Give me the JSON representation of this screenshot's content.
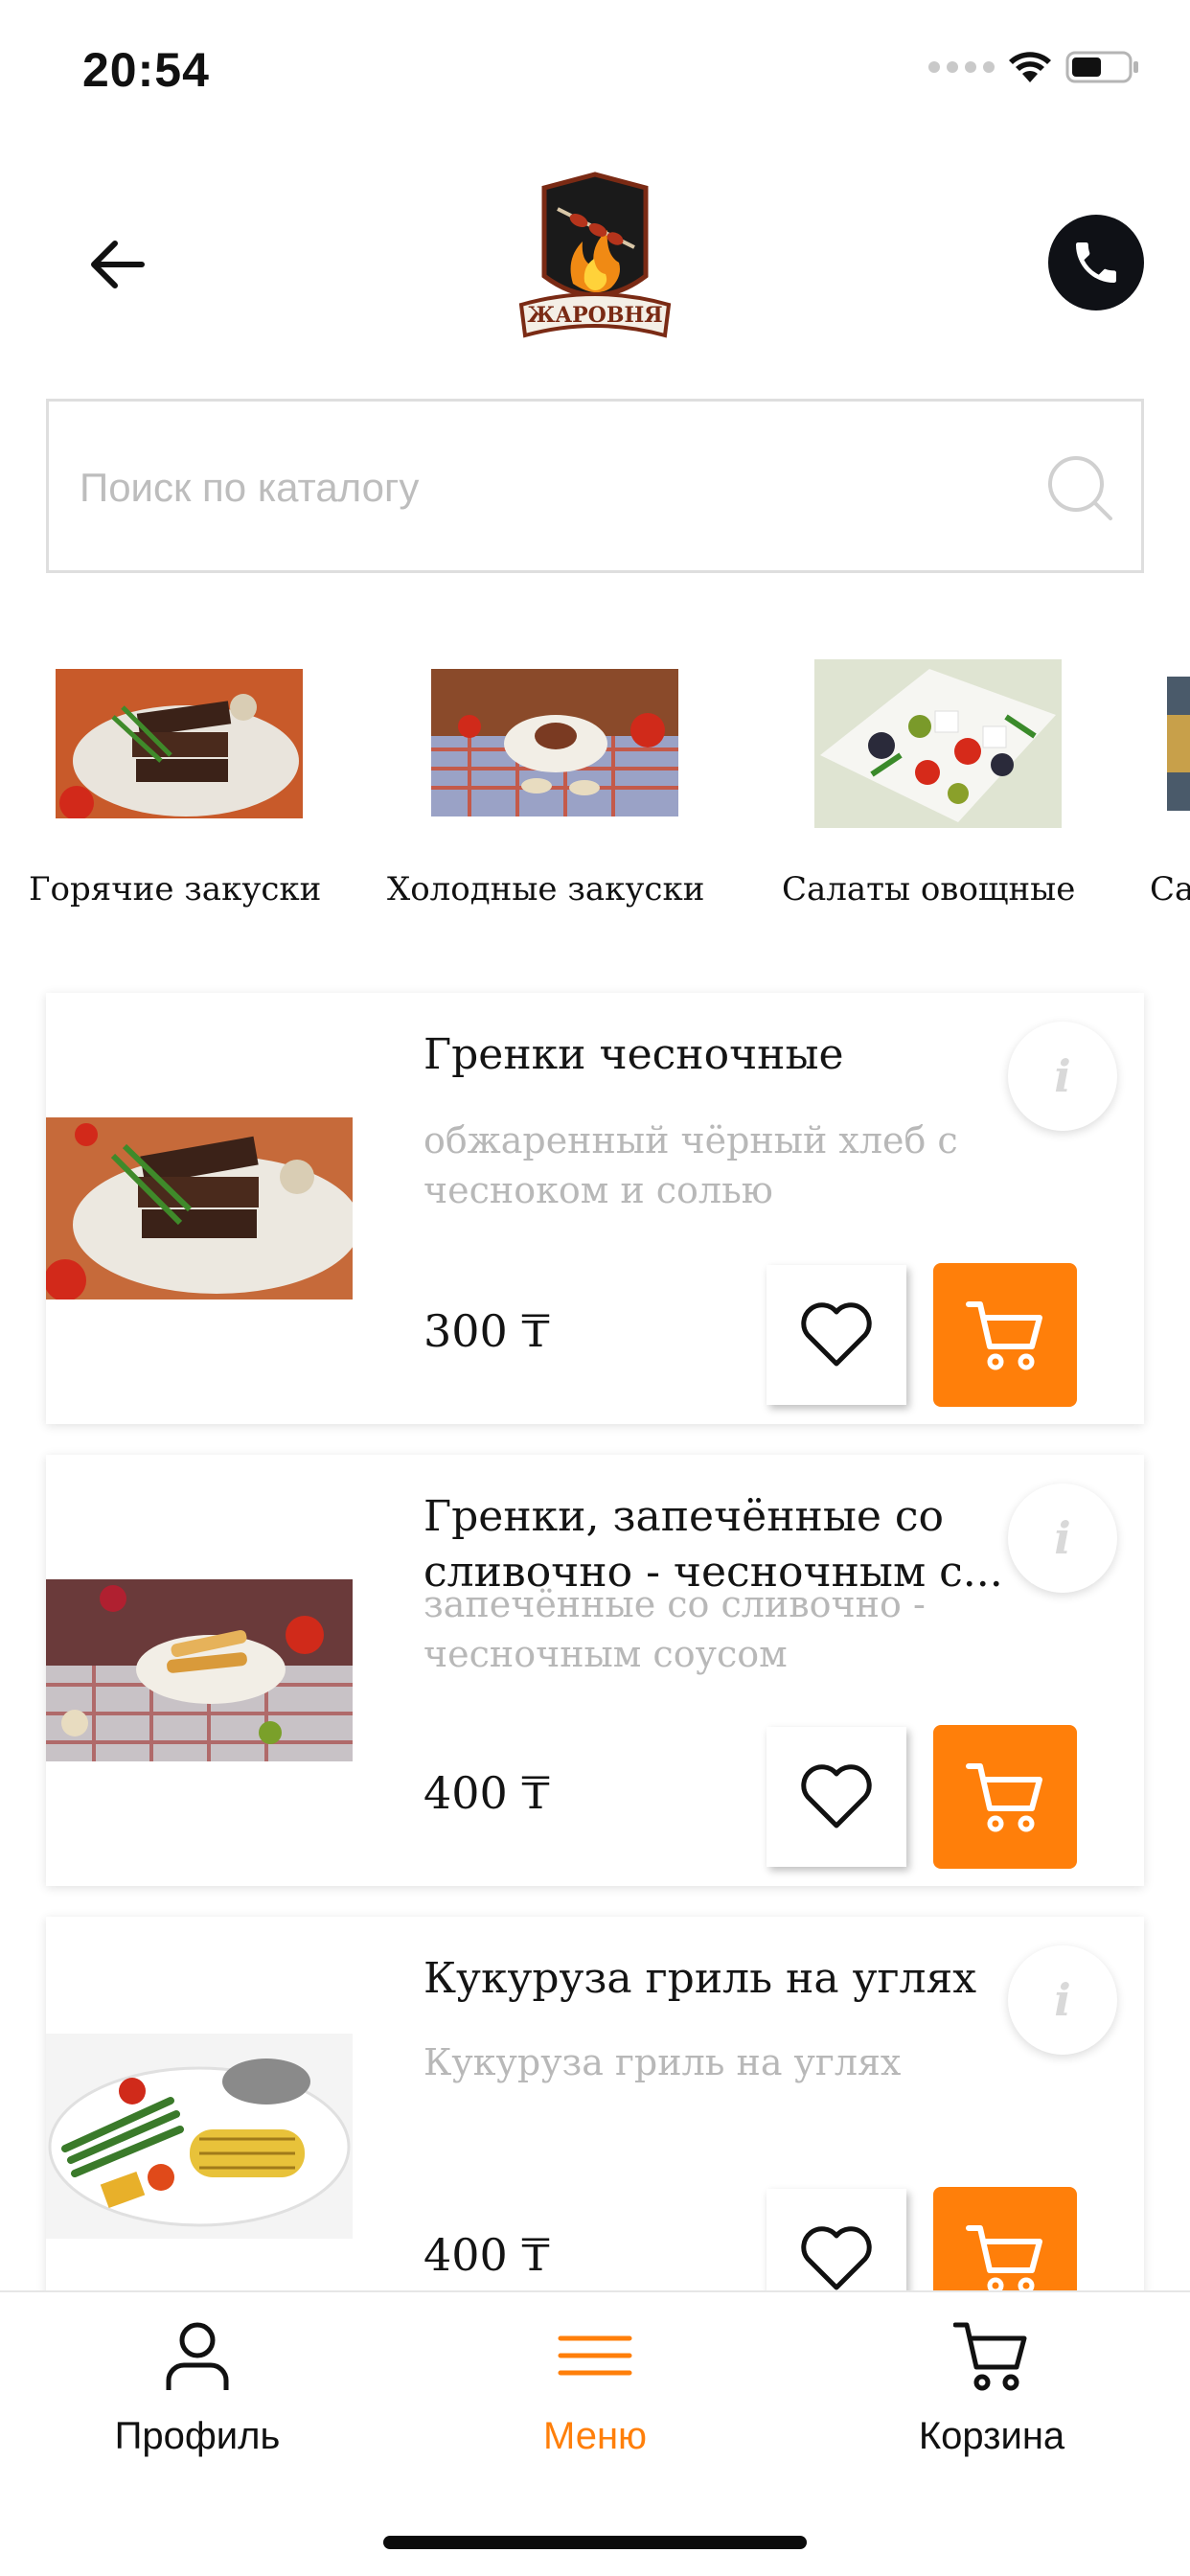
{
  "status_bar": {
    "time": "20:54",
    "icons": [
      "signal-dots-icon",
      "wifi-icon",
      "battery-icon"
    ]
  },
  "header": {
    "back_icon": "arrow-left-icon",
    "logo_text": "ЖАРОВНЯ",
    "phone_icon": "phone-icon"
  },
  "search": {
    "placeholder": "Поиск по каталогу",
    "value": "",
    "icon": "search-icon"
  },
  "categories": [
    {
      "label": "Горячие закуски"
    },
    {
      "label": "Холодные закуски"
    },
    {
      "label": "Салаты овощные"
    },
    {
      "label": "Са"
    }
  ],
  "products": [
    {
      "title": "Гренки чесночные",
      "description": "обжаренный чёрный хлеб с чесноком и солью",
      "price": "300 ₸"
    },
    {
      "title": "Гренки, запечённые со сливочно - чесночным с...",
      "description": "запечённые со сливочно - чесночным соусом",
      "price": "400 ₸"
    },
    {
      "title": "Кукуруза гриль на углях",
      "description": "Кукуруза гриль на углях",
      "price": "400 ₸"
    }
  ],
  "product_actions": {
    "info_glyph": "i",
    "favorite_icon": "heart-icon",
    "cart_icon": "cart-icon"
  },
  "tab_bar": {
    "tabs": [
      {
        "label": "Профиль",
        "icon": "user-icon",
        "active": false
      },
      {
        "label": "Меню",
        "icon": "menu-icon",
        "active": true
      },
      {
        "label": "Корзина",
        "icon": "cart-icon",
        "active": false
      }
    ]
  },
  "colors": {
    "accent": "#ff7f0a",
    "text": "#141414",
    "muted": "#b8b8b8",
    "phone_button": "#0f1116"
  }
}
